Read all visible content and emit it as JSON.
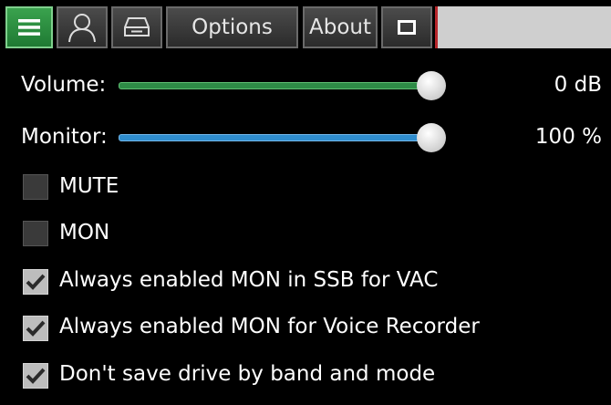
{
  "toolbar": {
    "menu_icon": "hamburger-icon",
    "user_icon": "user-icon",
    "drive_icon": "drive-icon",
    "options_label": "Options",
    "about_label": "About",
    "square_icon": "window-square-icon",
    "accent_color": "#2e9a45"
  },
  "volume": {
    "label": "Volume:",
    "value": "0 dB",
    "level": 1.0,
    "color": "#2e8b46"
  },
  "monitor": {
    "label": "Monitor:",
    "value": "100 %",
    "level": 1.0,
    "color": "#2f8dce"
  },
  "checkboxes": [
    {
      "label": "MUTE",
      "checked": false
    },
    {
      "label": "MON",
      "checked": false
    },
    {
      "label": "Always enabled MON in SSB for VAC",
      "checked": true
    },
    {
      "label": "Always enabled MON for Voice Recorder",
      "checked": true
    },
    {
      "label": "Don't save drive by band and mode",
      "checked": true
    }
  ]
}
